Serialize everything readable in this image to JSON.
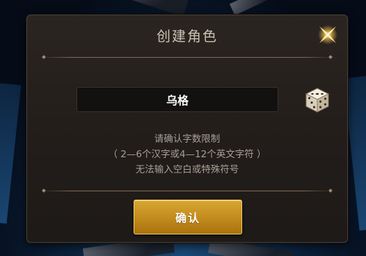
{
  "dialog": {
    "title": "创建角色",
    "name_input": {
      "value": "乌格"
    },
    "hint_lines": [
      "请确认字数限制",
      "（ 2—6个汉字或4—12个英文字符 ）",
      "无法输入空白或特殊符号"
    ],
    "confirm_label": "确认"
  },
  "icons": {
    "close": "close-star-icon",
    "randomize": "dice-icon"
  },
  "colors": {
    "accent_gold": "#c48d1e",
    "panel_bg": "#241f1b",
    "title_text": "#c9c2b4",
    "hint_text": "#a7a097"
  }
}
